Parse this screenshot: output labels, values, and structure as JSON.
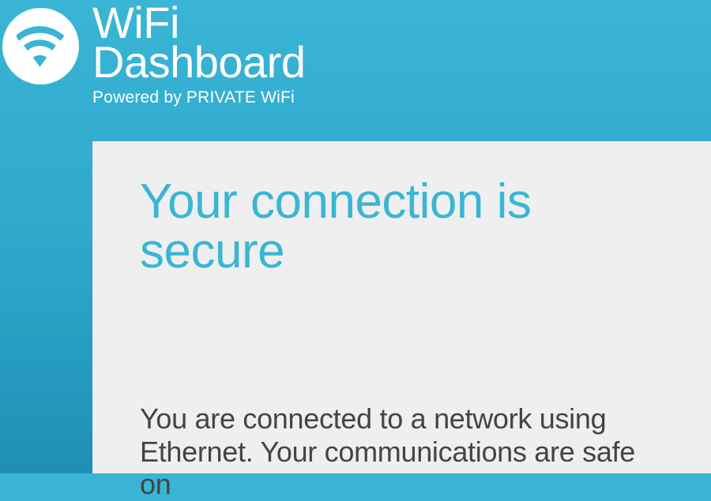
{
  "colors": {
    "accent": "#3AB5D5",
    "panel_bg": "#EFEFEF"
  },
  "header": {
    "title_line1": "WiFi",
    "title_line2": "Dashboard",
    "powered_by": "Powered by PRIVATE WiFi",
    "icon_name": "wifi-icon"
  },
  "main": {
    "heading": "Your connection is secure",
    "body": "You are connected to a network using Ethernet. Your communications are safe on"
  }
}
